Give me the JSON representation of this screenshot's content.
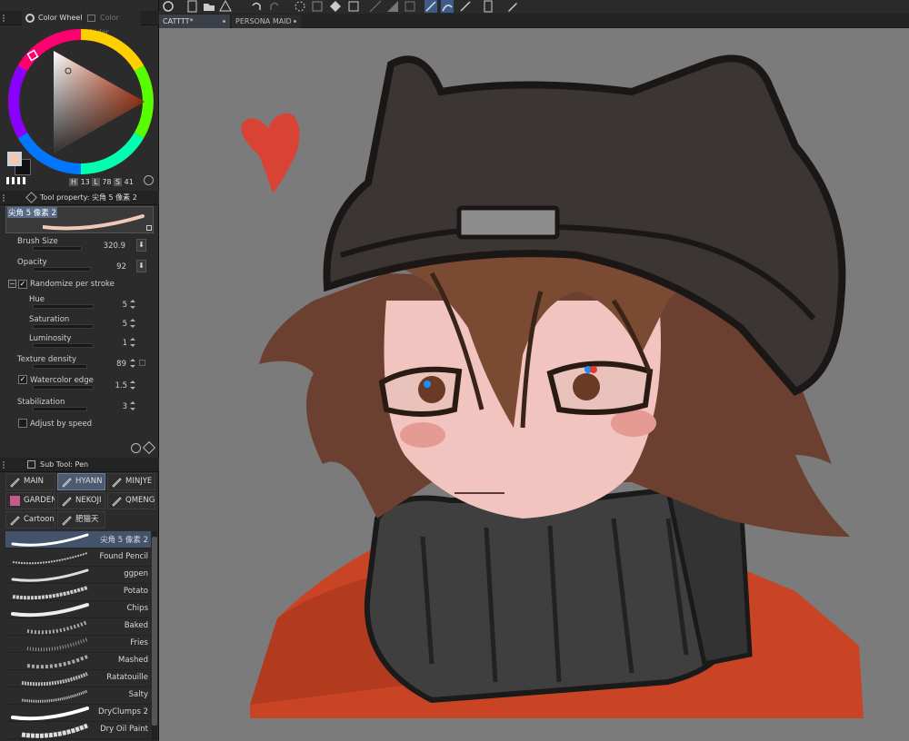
{
  "color_panel": {
    "tabs": [
      "Color Wheel",
      "Color Slider"
    ],
    "hsl": {
      "h_label": "H",
      "h": "13",
      "l_label": "L",
      "l": "78",
      "s_label": "S",
      "s": "41"
    },
    "main_color": "#f0c9b9",
    "sub_color": "#111111"
  },
  "tool_property": {
    "header": "Tool property: 尖角 5 像素 2",
    "brush_name": "尖角 5 像素 2",
    "params": {
      "brush_size": {
        "label": "Brush Size",
        "value": "320.9"
      },
      "opacity": {
        "label": "Opacity",
        "value": "92"
      },
      "randomize": {
        "label": "Randomize per stroke"
      },
      "hue": {
        "label": "Hue",
        "value": "5"
      },
      "saturation": {
        "label": "Saturation",
        "value": "5"
      },
      "luminosity": {
        "label": "Luminosity",
        "value": "1"
      },
      "texture_density": {
        "label": "Texture density",
        "value": "89"
      },
      "watercolor_edge": {
        "label": "Watercolor edge",
        "value": "1.5"
      },
      "stabilization": {
        "label": "Stabilization",
        "value": "3"
      },
      "adjust_by_speed": {
        "label": "Adjust by speed"
      }
    }
  },
  "sub_tool": {
    "header": "Sub Tool: Pen",
    "groups": [
      "MAIN",
      "HYANN",
      "MINJYE",
      "GARDEN",
      "NEKOJI",
      "QMENG",
      "Cartoon",
      "肥猫天"
    ],
    "brushes": [
      "尖角 5 像素 2",
      "Found Pencil",
      "ggpen",
      "Potato",
      "Chips",
      "Baked",
      "Fries",
      "Mashed",
      "Ratatouille",
      "Salty",
      "DryClumps 2",
      "Dry Oil Paint"
    ]
  },
  "documents": {
    "tabs": [
      "CATTTT*",
      "PERSONA MAID"
    ]
  },
  "toolbar": {
    "icons": [
      "app-icon",
      "new-icon",
      "open-icon",
      "save-icon",
      "undo-icon",
      "redo-icon",
      "loading-icon",
      "transform-icon",
      "fill-icon",
      "select-icon",
      "snap-icon",
      "ruler-icon",
      "pen-icon",
      "guide-icon",
      "layer-icon",
      "settings-icon"
    ]
  },
  "colors": {
    "accent": "#4d5a70",
    "canvas_bg": "#7b7b7b"
  }
}
